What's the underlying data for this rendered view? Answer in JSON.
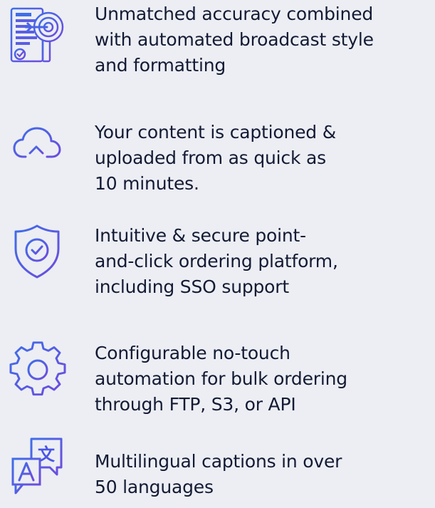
{
  "colors": {
    "background": "#eceef4",
    "text": "#131a33",
    "accent_blue": "#3f6ee8",
    "accent_purple": "#6f4bdc"
  },
  "features": [
    {
      "icon": "target-document-icon",
      "text": "Unmatched accuracy combined\nwith automated broadcast style\nand formatting"
    },
    {
      "icon": "cloud-upload-icon",
      "text": "Your content is captioned &\nuploaded from as quick as\n10 minutes."
    },
    {
      "icon": "shield-check-icon",
      "text": "Intuitive & secure point-\nand-click ordering platform,\nincluding SSO support"
    },
    {
      "icon": "gear-icon",
      "text": "Configurable no-touch\nautomation for bulk ordering\nthrough FTP, S3, or API"
    },
    {
      "icon": "translate-icon",
      "text": "Multilingual captions in over\n50 languages"
    }
  ]
}
